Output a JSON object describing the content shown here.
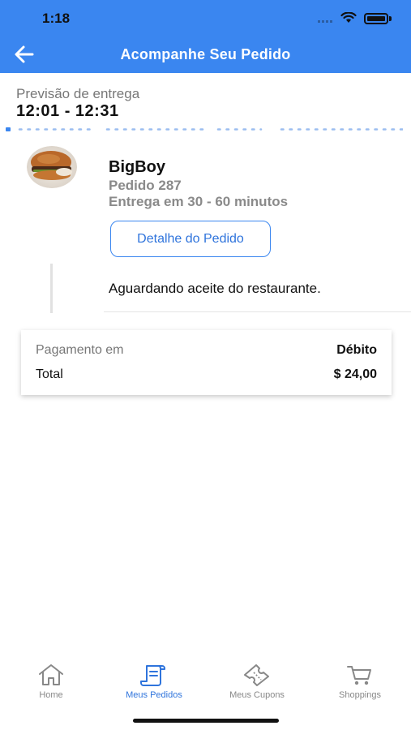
{
  "status_bar": {
    "time": "1:18"
  },
  "header": {
    "title": "Acompanhe Seu Pedido",
    "back_icon": "arrow-left-icon",
    "color": "#3a86f0"
  },
  "delivery": {
    "label": "Previsão de entrega",
    "window": "12:01 - 12:31"
  },
  "order": {
    "restaurant": "BigBoy",
    "number": "Pedido 287",
    "eta": "Entrega em 30 - 60 minutos",
    "detail_button": "Detalhe do Pedido",
    "status": "Aguardando aceite do restaurante."
  },
  "payment": {
    "label": "Pagamento em",
    "method": "Débito",
    "total_label": "Total",
    "total_value": "$ 24,00"
  },
  "tabs": [
    {
      "label": "Home",
      "icon": "home-icon",
      "active": false
    },
    {
      "label": "Meus Pedidos",
      "icon": "receipt-icon",
      "active": true
    },
    {
      "label": "Meus Cupons",
      "icon": "ticket-icon",
      "active": false
    },
    {
      "label": "Shoppings",
      "icon": "cart-icon",
      "active": false
    }
  ]
}
